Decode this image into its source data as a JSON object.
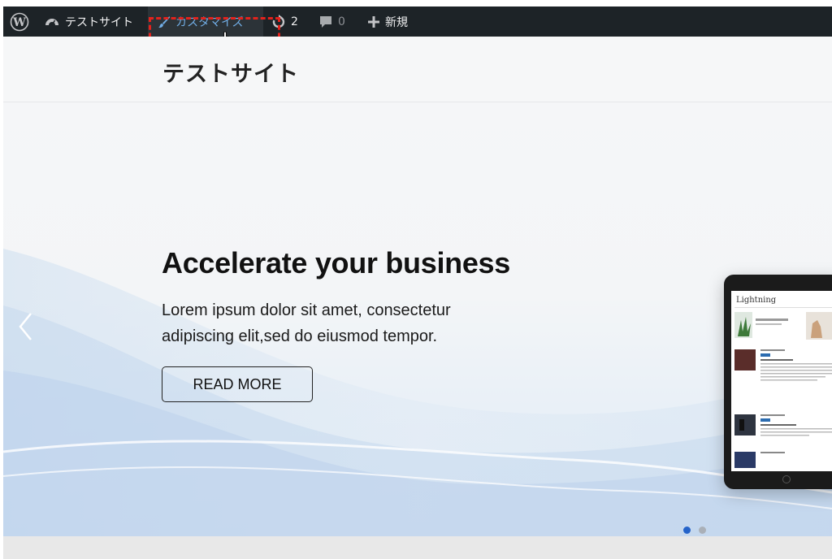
{
  "admin_bar": {
    "site_name": "テストサイト",
    "customize_label": "カスタマイズ",
    "updates_count": "2",
    "comments_count": "0",
    "new_label": "新規"
  },
  "header": {
    "site_title": "テストサイト"
  },
  "hero": {
    "title": "Accelerate your business",
    "text": "Lorem ipsum dolor sit amet, consectetur adipiscing elit,sed do eiusmod tempor.",
    "button_label": "READ MORE",
    "slide_count": 2,
    "active_slide": 1
  },
  "tablet_preview": {
    "brand": "Lightning"
  },
  "colors": {
    "admin_bar_bg": "#1d2327",
    "customize_text": "#72aee6",
    "highlight_box": "#e3221c",
    "dot_active": "#2563c9",
    "dot_inactive": "#aab0b8"
  }
}
